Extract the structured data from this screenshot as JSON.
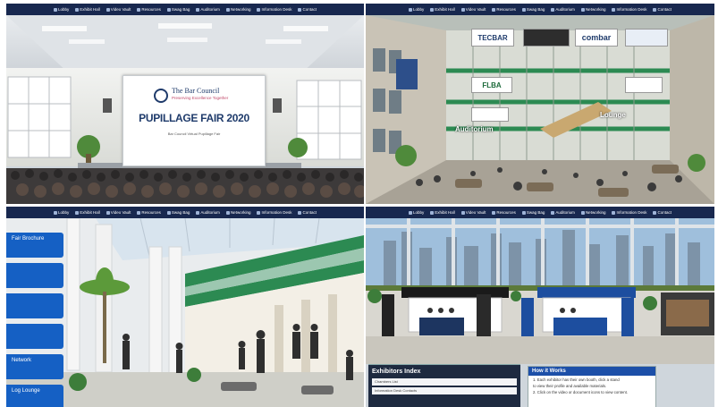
{
  "nav_items": [
    "Lobby",
    "Exhibit Hall",
    "Video Vault",
    "Resources",
    "Swag Bag",
    "Auditorium",
    "Networking",
    "Information Desk",
    "Contact"
  ],
  "auditorium_slide": {
    "org": "The Bar Council",
    "org_tagline": "Preserving Excellence Together",
    "title": "PUPILLAGE FAIR 2020",
    "subtitle": "Bar Council Virtual Pupillage Fair"
  },
  "lobby": {
    "banners": [
      "TECBAR",
      "combar",
      "FLBA"
    ],
    "labels": [
      "Lounge",
      "Auditorium"
    ]
  },
  "side_menu": {
    "items": [
      "Fair Brochure",
      "",
      "",
      "",
      "Network",
      "Log Lounge"
    ]
  },
  "exhibitor_index": {
    "title": "Exhibitors Index",
    "rows": [
      "Chambers List",
      "Information Desk Contacts"
    ]
  },
  "how_to": {
    "title": "How it Works",
    "lines": [
      "1. Each exhibitor has their own booth, click a stand",
      "   to view their profile and available materials.",
      "2. Click on the video or document icons to view content."
    ]
  },
  "colors": {
    "nav_bg": "#18284f",
    "side_blue": "#1560c4",
    "accent_green": "#2c8a52",
    "booth_blue": "#1d4e9f"
  }
}
